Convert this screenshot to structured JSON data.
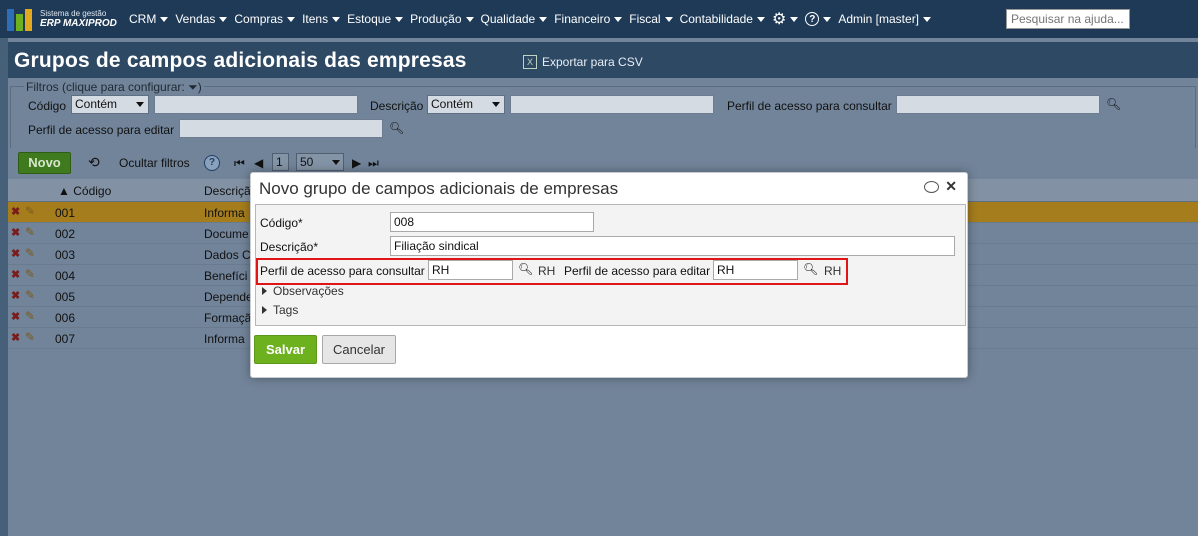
{
  "app": {
    "logo_line1": "Sistema de gestão",
    "logo_line2": "ERP MAXIPROD"
  },
  "menu": {
    "items": [
      "CRM",
      "Vendas",
      "Compras",
      "Itens",
      "Estoque",
      "Produção",
      "Qualidade",
      "Financeiro",
      "Fiscal",
      "Contabilidade"
    ],
    "user": "Admin [master]",
    "help_placeholder": "Pesquisar na ajuda..."
  },
  "page": {
    "title": "Grupos de campos adicionais das empresas",
    "export_label": "Exportar para CSV"
  },
  "filters": {
    "legend": "Filtros (clique para configurar:",
    "codigo_label": "Código",
    "codigo_op": "Contém",
    "descricao_label": "Descrição",
    "descricao_op": "Contém",
    "consultar_label": "Perfil de acesso para consultar",
    "editar_label": "Perfil de acesso para editar"
  },
  "toolbar": {
    "novo": "Novo",
    "ocultar": "Ocultar filtros",
    "page": "1",
    "page_size": "50"
  },
  "grid": {
    "col_codigo": "Código",
    "col_descricao": "Descriçã",
    "rows": [
      {
        "code": "001",
        "desc": "Informa"
      },
      {
        "code": "002",
        "desc": "Docume"
      },
      {
        "code": "003",
        "desc": "Dados C"
      },
      {
        "code": "004",
        "desc": "Benefíci"
      },
      {
        "code": "005",
        "desc": "Depende"
      },
      {
        "code": "006",
        "desc": "Formaçã"
      },
      {
        "code": "007",
        "desc": "Informa"
      }
    ]
  },
  "modal": {
    "title": "Novo grupo de campos adicionais de empresas",
    "codigo_label": "Código*",
    "codigo_value": "008",
    "descricao_label": "Descrição*",
    "descricao_value": "Filiação sindical",
    "consultar_label": "Perfil de acesso para consultar",
    "consultar_value": "RH",
    "consultar_display": "RH",
    "editar_label": "Perfil de acesso para editar",
    "editar_value": "RH",
    "editar_display": "RH",
    "observacoes": "Observações",
    "tags": "Tags",
    "salvar": "Salvar",
    "cancelar": "Cancelar"
  },
  "colors": {
    "accent_green": "#6db21e",
    "highlight_red": "#e01515",
    "topbar": "#1e3a57"
  }
}
